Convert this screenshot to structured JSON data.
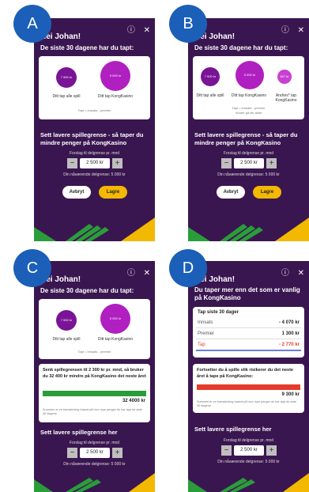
{
  "badges": {
    "a": "A",
    "b": "B",
    "c": "C",
    "d": "D"
  },
  "icons": {
    "info": "ⓘ",
    "close": "✕"
  },
  "common": {
    "greeting": "Hei Johan!",
    "loss_title": "De siste 30 dagene har du tapt:",
    "your_loss_all": "Ditt tap alle spill",
    "your_loss_kong": "Ditt tap KongKasino",
    "others_loss": "Andres* tap KongKasino",
    "others_note": "*Andre på din alder",
    "loss_def": "Tapt = innsats - premier",
    "set_lower_heading": "Sett lavere spillegrense - så taper du mindre penger på KongKasino",
    "set_lower_here": "Sett lavere spillegrense her",
    "suggestion": "Forslag til delgrense pr. mnd",
    "stepper_value": "2 500 kr",
    "current_limit": "Din nåværende delgrense: 5 000 kr",
    "cancel": "Avbryt",
    "save": "Lagre"
  },
  "circles": {
    "all": "7 500 kr",
    "kong": "5 000 kr",
    "others": "827 kr"
  },
  "panel_c": {
    "message": "Senk spillegrensen til 2 300 kr pr. mnd, så bruker du 32 400 kr mindre på KongKasino det neste året",
    "amount": "32 4000 kr",
    "footnote": "Summen er en framskriving basert på hvor mye penger du har tapt de siste 30 dagene"
  },
  "panel_d": {
    "heading": "Du taper mer enn det som er vanlig på KongKasino",
    "table_title": "Tap siste 30 dager",
    "rows": [
      {
        "label": "Innsats",
        "value": "- 4 070 kr"
      },
      {
        "label": "Premier",
        "value": "1 300 kr"
      },
      {
        "label": "Tap",
        "value": "- 2 770 kr"
      }
    ],
    "warn": "Fortsetter du å spille slik risikerer du det neste året å tape på KongKasino:",
    "amount": "9 300 kr",
    "footnote": "Summen er en framskriving basert på hvor mye penger du har tapt de siste 30 dagene"
  },
  "colors": {
    "bg": "#3a1650",
    "circle": "#b01fc0",
    "accent": "#f3b800",
    "green": "#2a9d3a",
    "red": "#e53b2a",
    "badge": "#1b5fb8"
  }
}
